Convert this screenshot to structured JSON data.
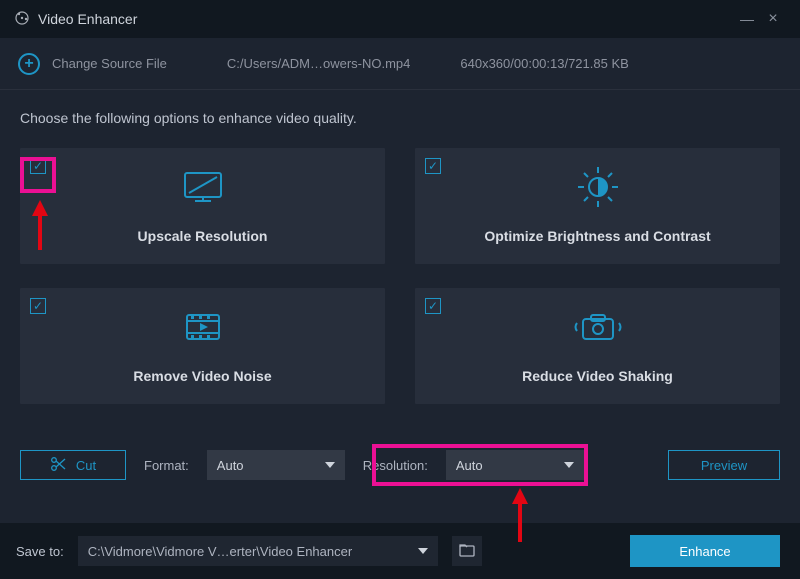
{
  "window": {
    "title": "Video Enhancer",
    "minimize": "—",
    "close": "×"
  },
  "source": {
    "change_label": "Change Source File",
    "file_path": "C:/Users/ADM…owers-NO.mp4",
    "meta": "640x360/00:00:13/721.85 KB"
  },
  "instruction": "Choose the following options to enhance video quality.",
  "options": [
    {
      "label": "Upscale Resolution",
      "checked": true
    },
    {
      "label": "Optimize Brightness and Contrast",
      "checked": true
    },
    {
      "label": "Remove Video Noise",
      "checked": true
    },
    {
      "label": "Reduce Video Shaking",
      "checked": true
    }
  ],
  "toolbar": {
    "cut_label": "Cut",
    "format_label": "Format:",
    "resolution_label": "Resolution:",
    "selects": {
      "format_value": "Auto",
      "resolution_value": "Auto"
    },
    "preview_label": "Preview"
  },
  "footer": {
    "save_to_label": "Save to:",
    "save_path": "C:\\Vidmore\\Vidmore V…erter\\Video Enhancer",
    "enhance_label": "Enhance"
  }
}
